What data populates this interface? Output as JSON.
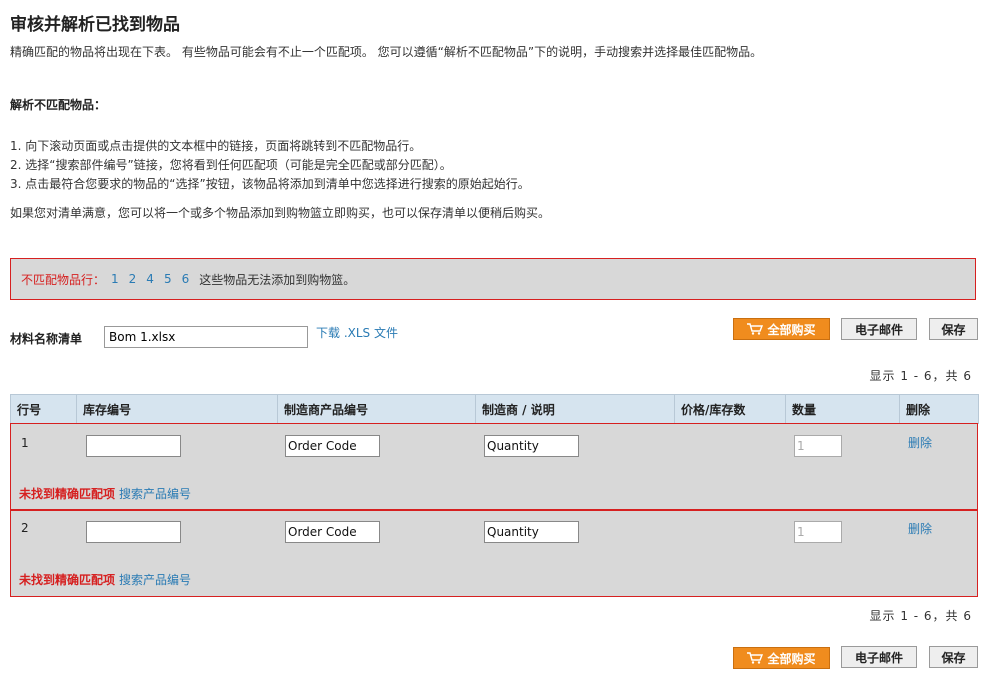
{
  "title": "审核并解析已找到物品",
  "intro": "精确匹配的物品将出现在下表。 有些物品可能会有不止一个匹配项。 您可以遵循“解析不匹配物品”下的说明，手动搜索并选择最佳匹配物品。",
  "subhead": "解析不匹配物品：",
  "steps": [
    "1. 向下滚动页面或点击提供的文本框中的链接，页面将跳转到不匹配物品行。",
    "2. 选择“搜索部件编号”链接，您将看到任何匹配项（可能是完全匹配或部分匹配）。",
    "3. 点击最符合您要求的物品的“选择”按钮，该物品将添加到清单中您选择进行搜索的原始起始行。"
  ],
  "footnote": "如果您对清单满意，您可以将一个或多个物品添加到购物篮立即购买，也可以保存清单以便稍后购买。",
  "alert": {
    "label": "不匹配物品行：",
    "rows": [
      "1",
      "2",
      "4",
      "5",
      "6"
    ],
    "message": "这些物品无法添加到购物篮。"
  },
  "bom": {
    "label": "材料名称清单",
    "name": "Bom 1.xlsx",
    "download": "下载 .XLS 文件"
  },
  "actions": {
    "buy_all": "全部购买",
    "email": "电子邮件",
    "save": "保存"
  },
  "showing": "显示 1 - 6，共 6",
  "table": {
    "headers": [
      "行号",
      "库存编号",
      "制造商产品编号",
      "制造商 / 说明",
      "价格/库存数",
      "数量",
      "删除"
    ],
    "rows": [
      {
        "line": "1",
        "stock": "",
        "order_code": "Order Code",
        "quantity_text": "Quantity",
        "qty": "1",
        "delete": "删除",
        "nomatch": "未找到精确匹配项",
        "search": "搜索产品编号"
      },
      {
        "line": "2",
        "stock": "",
        "order_code": "Order Code",
        "quantity_text": "Quantity",
        "qty": "1",
        "delete": "删除",
        "nomatch": "未找到精确匹配项",
        "search": "搜索产品编号"
      }
    ]
  },
  "colors": {
    "accent_orange": "#f08c1e",
    "error_red": "#d62020",
    "link_blue": "#2a7bb4",
    "header_blue": "#d6e4ef"
  }
}
